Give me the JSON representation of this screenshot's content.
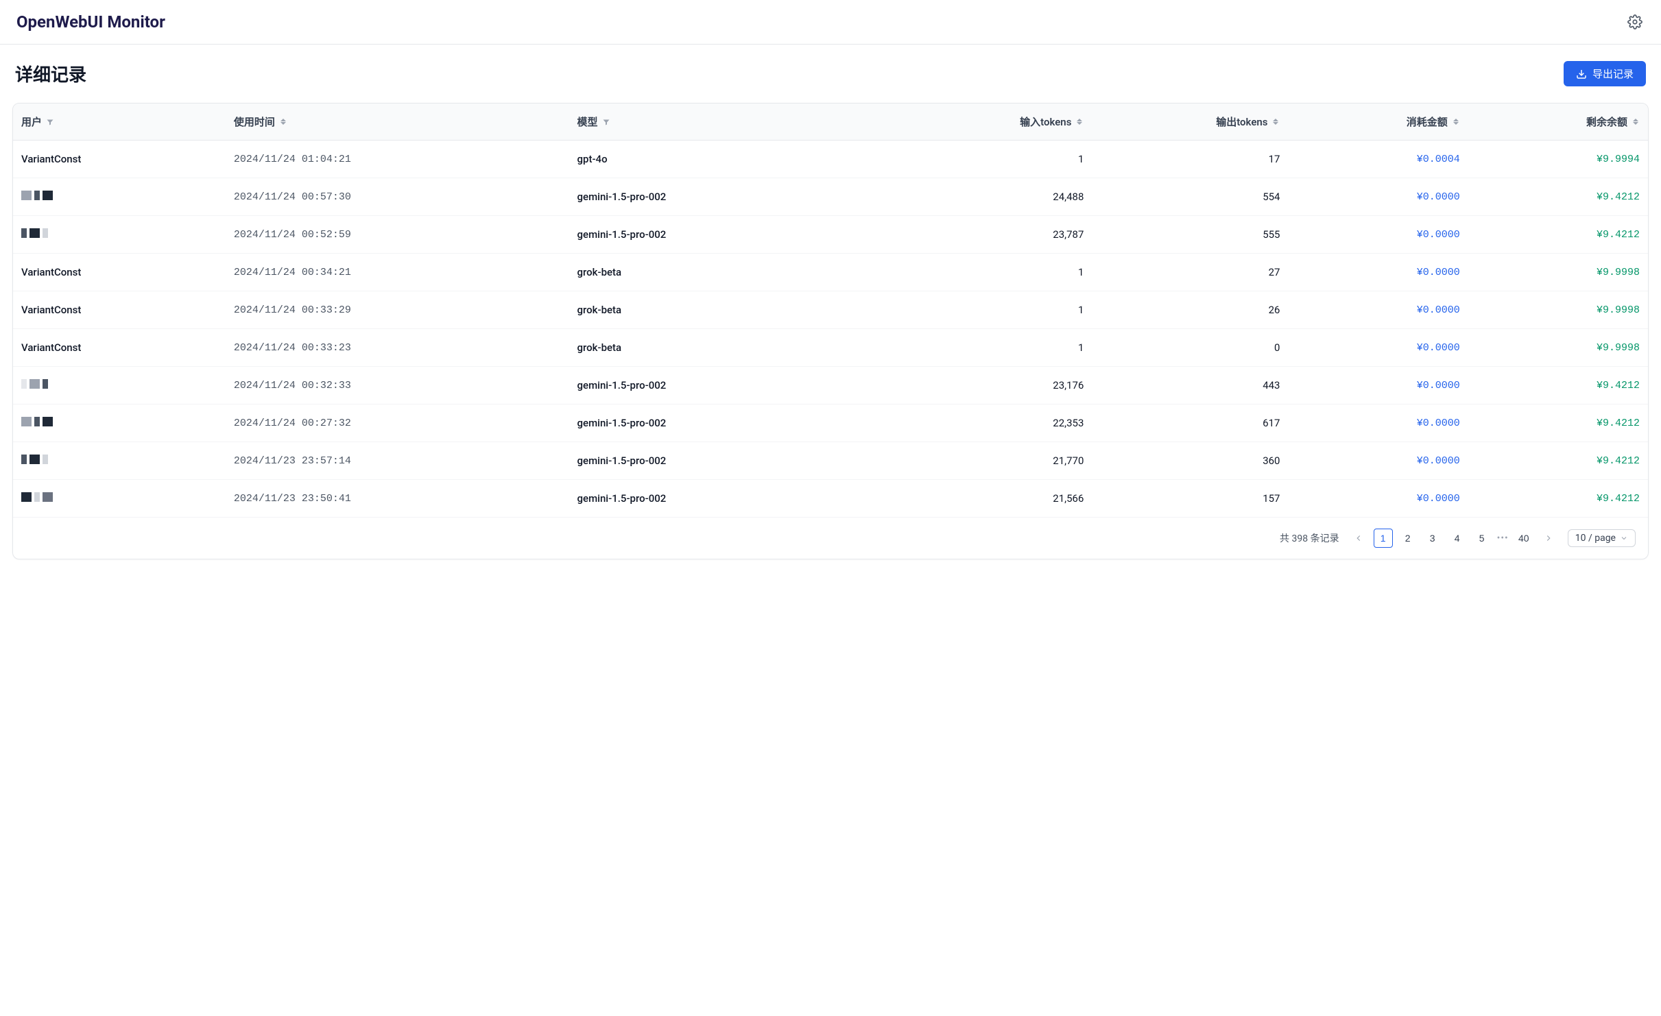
{
  "brand": "OpenWebUI Monitor",
  "page_title": "详细记录",
  "export_label": "导出记录",
  "columns": {
    "user": "用户",
    "time": "使用时间",
    "model": "模型",
    "input_tokens": "输入tokens",
    "output_tokens": "输出tokens",
    "cost": "消耗金额",
    "balance": "剩余余额"
  },
  "rows": [
    {
      "user": "VariantConst",
      "redacted": false,
      "time": "2024/11/24 01:04:21",
      "model": "gpt-4o",
      "input": "1",
      "output": "17",
      "cost": "¥0.0004",
      "balance": "¥9.9994"
    },
    {
      "user": "",
      "redacted": true,
      "time": "2024/11/24 00:57:30",
      "model": "gemini-1.5-pro-002",
      "input": "24,488",
      "output": "554",
      "cost": "¥0.0000",
      "balance": "¥9.4212"
    },
    {
      "user": "",
      "redacted": true,
      "time": "2024/11/24 00:52:59",
      "model": "gemini-1.5-pro-002",
      "input": "23,787",
      "output": "555",
      "cost": "¥0.0000",
      "balance": "¥9.4212"
    },
    {
      "user": "VariantConst",
      "redacted": false,
      "time": "2024/11/24 00:34:21",
      "model": "grok-beta",
      "input": "1",
      "output": "27",
      "cost": "¥0.0000",
      "balance": "¥9.9998"
    },
    {
      "user": "VariantConst",
      "redacted": false,
      "time": "2024/11/24 00:33:29",
      "model": "grok-beta",
      "input": "1",
      "output": "26",
      "cost": "¥0.0000",
      "balance": "¥9.9998"
    },
    {
      "user": "VariantConst",
      "redacted": false,
      "time": "2024/11/24 00:33:23",
      "model": "grok-beta",
      "input": "1",
      "output": "0",
      "cost": "¥0.0000",
      "balance": "¥9.9998"
    },
    {
      "user": "",
      "redacted": true,
      "time": "2024/11/24 00:32:33",
      "model": "gemini-1.5-pro-002",
      "input": "23,176",
      "output": "443",
      "cost": "¥0.0000",
      "balance": "¥9.4212"
    },
    {
      "user": "",
      "redacted": true,
      "time": "2024/11/24 00:27:32",
      "model": "gemini-1.5-pro-002",
      "input": "22,353",
      "output": "617",
      "cost": "¥0.0000",
      "balance": "¥9.4212"
    },
    {
      "user": "",
      "redacted": true,
      "time": "2024/11/23 23:57:14",
      "model": "gemini-1.5-pro-002",
      "input": "21,770",
      "output": "360",
      "cost": "¥0.0000",
      "balance": "¥9.4212"
    },
    {
      "user": "",
      "redacted": true,
      "time": "2024/11/23 23:50:41",
      "model": "gemini-1.5-pro-002",
      "input": "21,566",
      "output": "157",
      "cost": "¥0.0000",
      "balance": "¥9.4212"
    }
  ],
  "pagination": {
    "total_text": "共 398 条记录",
    "pages": [
      "1",
      "2",
      "3",
      "4",
      "5"
    ],
    "last_page": "40",
    "active": "1",
    "page_size_label": "10 / page"
  }
}
